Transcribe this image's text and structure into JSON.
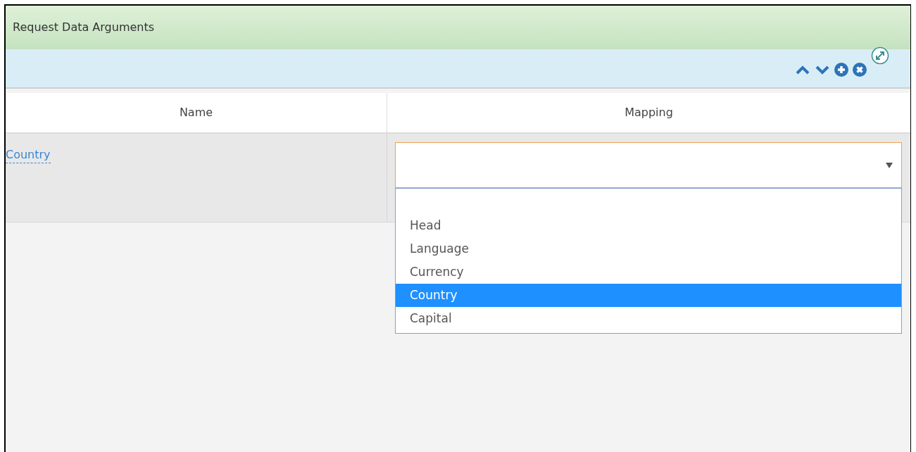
{
  "panel": {
    "title": "Request Data Arguments"
  },
  "toolbar": {
    "buttons": [
      {
        "kind": "up"
      },
      {
        "kind": "down"
      },
      {
        "kind": "add"
      },
      {
        "kind": "remove"
      },
      {
        "kind": "expand"
      }
    ]
  },
  "table": {
    "columns": [
      "Name",
      "Mapping"
    ],
    "rows": [
      {
        "name": "Country",
        "mapping": {
          "open": true,
          "options": [
            {
              "label": "Head",
              "selected": false
            },
            {
              "label": "Language",
              "selected": false
            },
            {
              "label": "Currency",
              "selected": false
            },
            {
              "label": "Country",
              "selected": true
            },
            {
              "label": "Capital",
              "selected": false
            }
          ]
        }
      }
    ]
  }
}
